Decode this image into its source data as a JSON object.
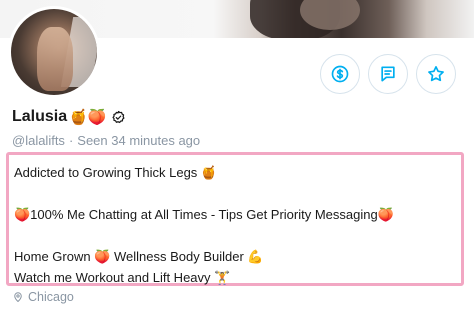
{
  "profile": {
    "name": "Lalusia",
    "name_emojis": "🍯🍑",
    "handle": "@lalalifts",
    "separator": "·",
    "last_seen": "Seen 34 minutes ago",
    "location": "Chicago"
  },
  "bio": {
    "line1": "Addicted to Growing Thick Legs 🍯",
    "line2": "🍑100% Me Chatting at All Times - Tips Get Priority Messaging🍑",
    "line3": "Home Grown 🍑 Wellness Body Builder 💪",
    "line4": "Watch me Workout and Lift Heavy 🏋️"
  },
  "actions": {
    "tip_icon": "dollar-circle-icon",
    "message_icon": "message-icon",
    "favorite_icon": "star-icon"
  },
  "colors": {
    "accent": "#00aff0",
    "highlight_border": "#f2a7c3",
    "muted_text": "#8a96a3"
  }
}
